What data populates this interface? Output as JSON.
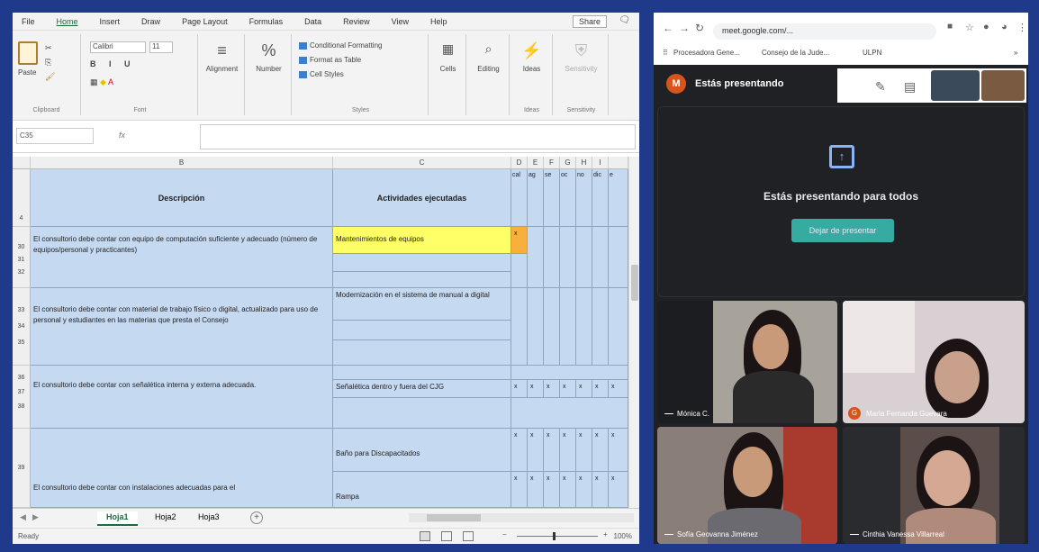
{
  "excel": {
    "menu": [
      "File",
      "Home",
      "Insert",
      "Draw",
      "Page Layout",
      "Formulas",
      "Data",
      "Review",
      "View",
      "Help"
    ],
    "share_label": "Share",
    "ribbon": {
      "paste": "Paste",
      "clipboard": "Clipboard",
      "font_name": "Calibri",
      "font_size": "11",
      "format_row": "B I U",
      "font_group": "Font",
      "alignment": "Alignment",
      "number": "Number",
      "styles": [
        "Conditional Formatting",
        "Format as Table",
        "Cell Styles"
      ],
      "styles_group": "Styles",
      "cells": "Cells",
      "editing": "Editing",
      "ideas": "Ideas",
      "sensitivity": "Sensitivity",
      "ideas_group": "Ideas",
      "sensitivity_group": "Sensitivity"
    },
    "name_box": "C35",
    "fx": "fx",
    "columns": {
      "A": "",
      "B": "B",
      "C": "C",
      "D": "D",
      "E": "E",
      "F": "F",
      "G": "G",
      "H": "H",
      "I": "I"
    },
    "header": {
      "descripcion": "Descripción",
      "actividades": "Actividades ejecutadas",
      "small": [
        "cal",
        "ag",
        "se",
        "oc",
        "no",
        "dic",
        "e"
      ]
    },
    "rows": [
      {
        "nums": "30\n31\n32",
        "desc": "El consultorio debe contar con equipo de computación suficiente y adecuado (número de equipos/personal y practicantes)",
        "act": "Mantenimientos de equipos"
      },
      {
        "nums": "33\n34\n35",
        "desc": "El consultorio debe contar con material de trabajo físico o digital, actualizado para uso de personal y estudiantes en las materias que presta el Consejo",
        "act": "Modernización en el sistema de manual a digital"
      },
      {
        "nums": "36\n37\n38",
        "desc": "El consultorio debe contar con señalética interna y externa adecuada.",
        "act": "Señalética dentro y fuera del CJG"
      },
      {
        "nums": "39",
        "desc": "El consultorio debe contar con instalaciones adecuadas para el",
        "act": "Baño para Discapacitados",
        "act2": "Rampa"
      }
    ],
    "x_mark": "x",
    "sheets": [
      "Hoja1",
      "Hoja2",
      "Hoja3"
    ],
    "status": "Ready",
    "zoom": "100%"
  },
  "browser": {
    "url": "meet.google.com/...",
    "bookmarks": [
      "Procesadora Gene...",
      "Consejo de la Jude...",
      "ULPN"
    ],
    "avatar_letter": "M",
    "presenting_label": "Estás presentando",
    "present_message": "Estás presentando para todos",
    "stop_button": "Dejar de presentar",
    "participants": [
      {
        "name": "Mónica C.",
        "letter": ""
      },
      {
        "name": "María Fernanda Guevara",
        "letter": "G"
      },
      {
        "name": "Sofía Geovanna Jiménez",
        "letter": ""
      },
      {
        "name": "Cinthia Vanessa Villarreal",
        "letter": ""
      }
    ]
  }
}
